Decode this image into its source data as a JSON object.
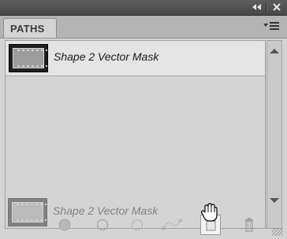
{
  "panel": {
    "tab_label": "PATHS",
    "menu_icon": "panel-menu-icon",
    "collapse_icon": "double-chevron-left-icon",
    "close_icon": "close-icon"
  },
  "paths": [
    {
      "name": "Shape 2 Vector Mask",
      "selected": true
    }
  ],
  "drag_ghost": {
    "name": "Shape 2 Vector Mask"
  },
  "bottom_buttons": [
    {
      "icon": "fill-path-icon"
    },
    {
      "icon": "stroke-path-icon"
    },
    {
      "icon": "load-path-as-selection-icon"
    },
    {
      "icon": "make-work-path-icon"
    },
    {
      "icon": "new-path-icon"
    },
    {
      "icon": "trash-icon"
    }
  ]
}
